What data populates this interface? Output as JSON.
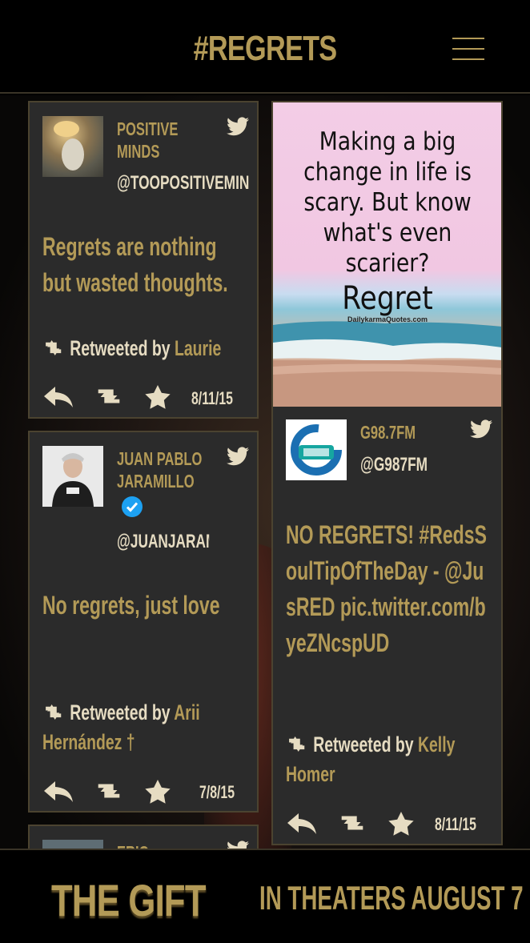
{
  "header": {
    "title": "#REGRETS",
    "menu_icon": "hamburger-menu-icon"
  },
  "tweets": [
    {
      "author": "POSITIVE MINDS",
      "handle": "@TOOPOSITIVEMIN",
      "text": "Regrets are nothing but wasted thoughts.",
      "retweeted_label": "Retweeted by",
      "retweeted_by": "Laurie",
      "date": "8/11/15"
    },
    {
      "author": "JUAN PABLO JARAMILLO",
      "handle": "@JUANJARAMILLO",
      "verified": true,
      "text": "No regrets, just love",
      "retweeted_label": "Retweeted by",
      "retweeted_by": "Arii Hernández †",
      "date": "7/8/15"
    },
    {
      "author": "ERIC CALBILLO"
    },
    {
      "image_quote": {
        "text": "Making a big change in life is scary. But know what's even scarier?",
        "emphasis": "Regret",
        "site": "DailykarmaQuotes.com"
      },
      "author": "G98.7FM",
      "handle": "@G987FM",
      "text": "NO REGRETS! #RedsSoulTipOfTheDay - @JusRED pic.twitter.com/byeZNcspUD",
      "retweeted_label": "Retweeted by",
      "retweeted_by": "Kelly Homer",
      "date": "8/11/15"
    }
  ],
  "footer": {
    "film_title": "THE GIFT",
    "release": "IN THEATERS AUGUST 7"
  },
  "colors": {
    "gold": "#b39a57",
    "card": "#2b2b2b",
    "text_light": "#e6dcc2",
    "twitter_blue": "#1da1f2"
  }
}
